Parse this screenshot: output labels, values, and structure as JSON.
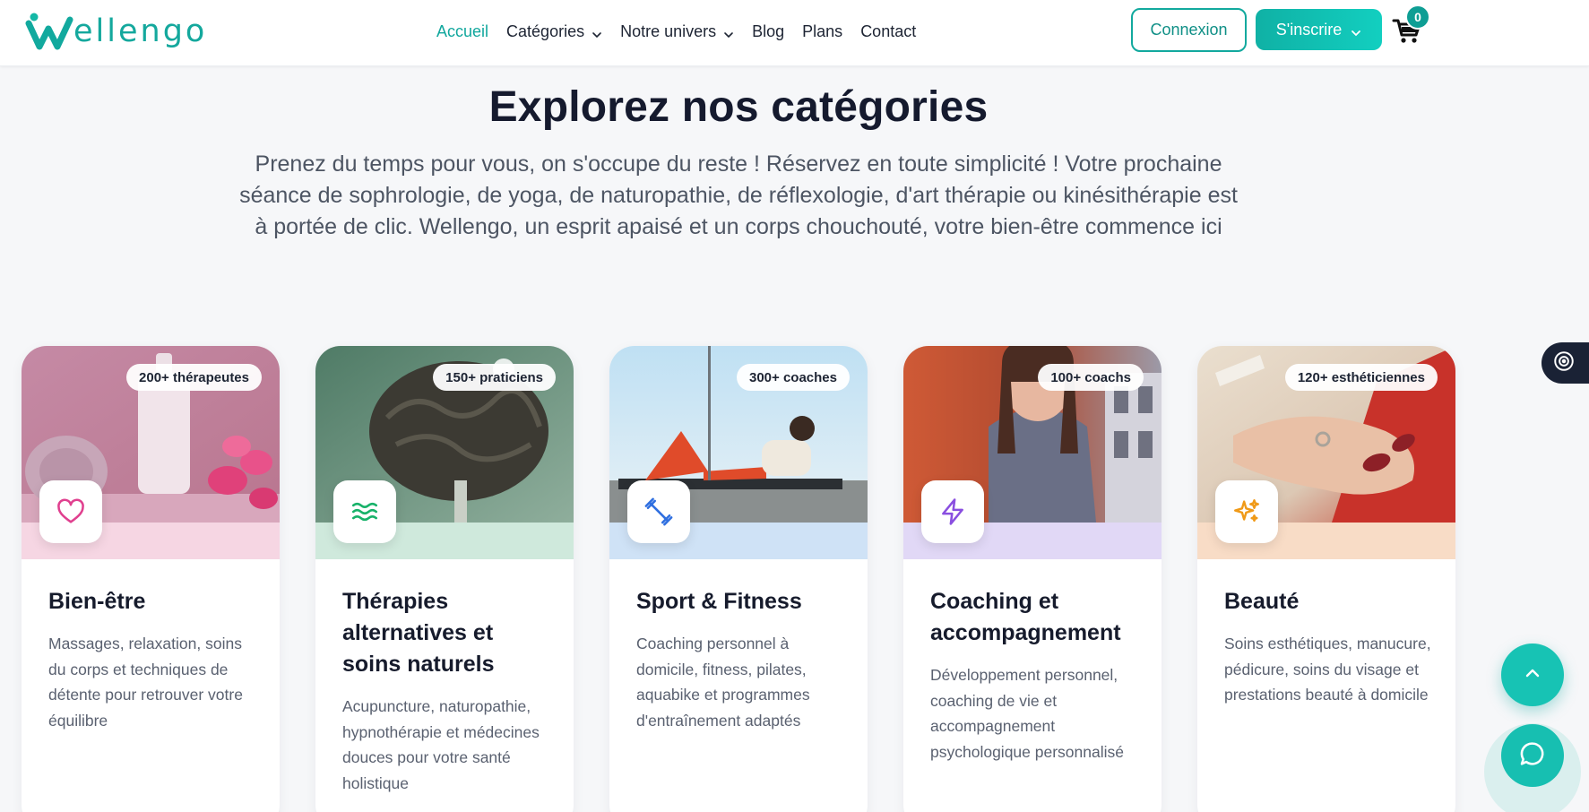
{
  "brand": {
    "name": "ellengo",
    "logo_letter": "W",
    "accent": "#11a79d"
  },
  "nav": {
    "items": [
      {
        "label": "Accueil",
        "active": true,
        "dropdown": false
      },
      {
        "label": "Catégories",
        "active": false,
        "dropdown": true
      },
      {
        "label": "Notre univers",
        "active": false,
        "dropdown": true
      },
      {
        "label": "Blog",
        "active": false,
        "dropdown": false
      },
      {
        "label": "Plans",
        "active": false,
        "dropdown": false
      },
      {
        "label": "Contact",
        "active": false,
        "dropdown": false
      }
    ]
  },
  "header": {
    "login_label": "Connexion",
    "signup_label": "S'inscrire",
    "cart_count": "0",
    "cart_icon": "cart-icon"
  },
  "hero": {
    "title": "Explorez nos catégories",
    "description": "Prenez du temps pour vous, on s'occupe du reste ! Réservez en toute simplicité ! Votre prochaine séance de sophrologie, de yoga, de naturopathie, de réflexologie, d'art thérapie ou kinésithérapie est à portée de clic. Wellengo, un esprit apaisé et un corps chouchouté, votre bien-être commence ici"
  },
  "categories": [
    {
      "badge": "200+ thérapeutes",
      "title": "Bien-être",
      "description": "Massages, relaxation, soins du corps et techniques de détente pour retrouver votre équilibre",
      "icon": "heart-icon",
      "icon_color": "#e0408f",
      "band_color": "#f6d6e3"
    },
    {
      "badge": "150+ praticiens",
      "title": "Thérapies alternatives et soins naturels",
      "description": "Acupuncture, naturopathie, hypnothérapie et médecines douces pour votre santé holistique",
      "icon": "waves-icon",
      "icon_color": "#18b26a",
      "band_color": "#cfe9dc"
    },
    {
      "badge": "300+ coaches",
      "title": "Sport & Fitness",
      "description": "Coaching personnel à domicile, fitness, pilates, aquabike et programmes d'entraînement adaptés",
      "icon": "dumbbell-icon",
      "icon_color": "#2f6fe0",
      "band_color": "#cfe2f6"
    },
    {
      "badge": "100+ coachs",
      "title": "Coaching et accompagnement",
      "description": "Développement personnel, coaching de vie et accompagnement psychologique personnalisé",
      "icon": "lightning-icon",
      "icon_color": "#8a4fe0",
      "band_color": "#e1d8f6"
    },
    {
      "badge": "120+ esthéticiennes",
      "title": "Beauté",
      "description": "Soins esthétiques, manucure, pédicure, soins du visage et prestations beauté à domicile",
      "icon": "sparkles-icon",
      "icon_color": "#f09a18",
      "band_color": "#f8dcc6"
    }
  ],
  "floating": {
    "side_tab_icon": "accessibility-icon",
    "scroll_top_icon": "chevron-up-icon",
    "chat_icon": "chat-bubble-icon"
  }
}
